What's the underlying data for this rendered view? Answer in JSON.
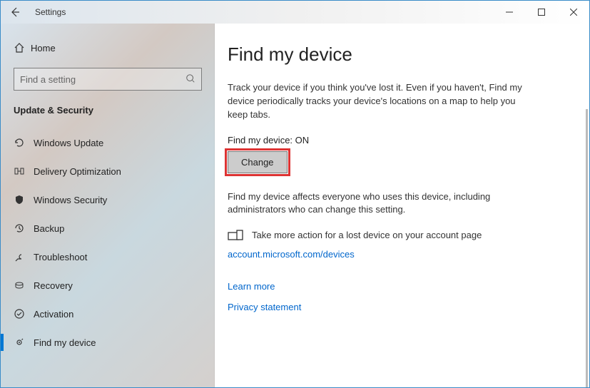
{
  "titlebar": {
    "title": "Settings"
  },
  "sidebar": {
    "home_label": "Home",
    "search_placeholder": "Find a setting",
    "category": "Update & Security",
    "items": [
      {
        "label": "Windows Update",
        "icon": "refresh-icon"
      },
      {
        "label": "Delivery Optimization",
        "icon": "delivery-icon"
      },
      {
        "label": "Windows Security",
        "icon": "shield-icon"
      },
      {
        "label": "Backup",
        "icon": "backup-icon"
      },
      {
        "label": "Troubleshoot",
        "icon": "troubleshoot-icon"
      },
      {
        "label": "Recovery",
        "icon": "recovery-icon"
      },
      {
        "label": "Activation",
        "icon": "activation-icon"
      },
      {
        "label": "Find my device",
        "icon": "location-icon",
        "active": true
      }
    ]
  },
  "main": {
    "title": "Find my device",
    "intro": "Track your device if you think you've lost it. Even if you haven't, Find my device periodically tracks your device's locations on a map to help you keep tabs.",
    "status": "Find my device: ON",
    "change_label": "Change",
    "affects": "Find my device affects everyone who uses this device, including administrators who can change this setting.",
    "action_text": "Take more action for a lost device on your account page",
    "account_link": "account.microsoft.com/devices",
    "learn_more": "Learn more",
    "privacy": "Privacy statement"
  }
}
